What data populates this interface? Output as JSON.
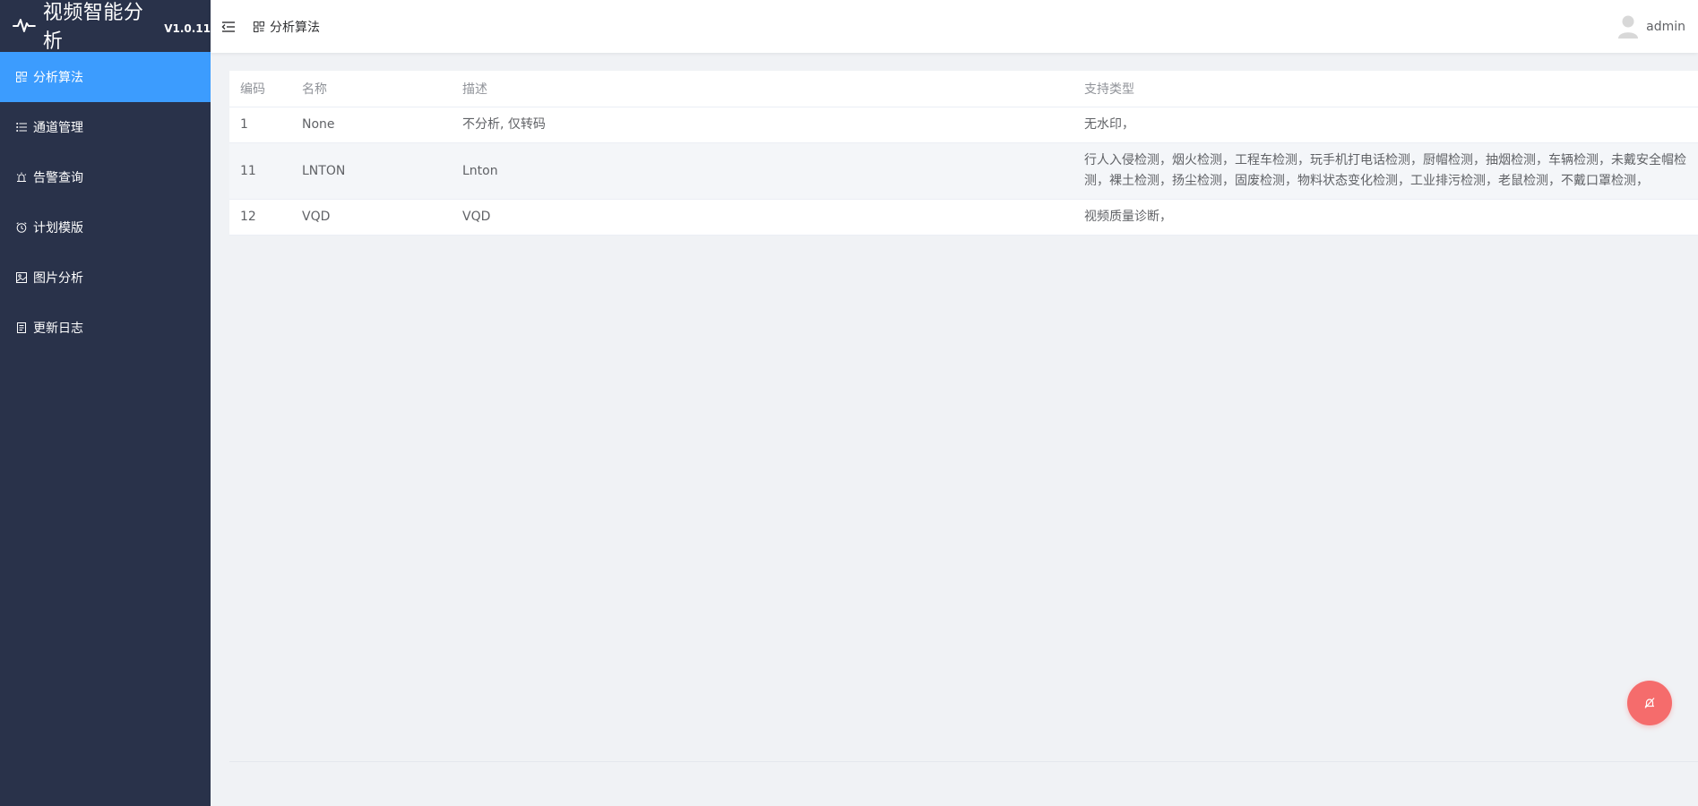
{
  "app": {
    "title": "视频智能分析",
    "version": "V1.0.11"
  },
  "sidebar": {
    "items": [
      {
        "label": "分析算法",
        "icon": "algorithm-icon",
        "active": true
      },
      {
        "label": "通道管理",
        "icon": "list-icon",
        "active": false
      },
      {
        "label": "告警查询",
        "icon": "alarm-icon",
        "active": false
      },
      {
        "label": "计划模版",
        "icon": "clock-icon",
        "active": false
      },
      {
        "label": "图片分析",
        "icon": "picture-icon",
        "active": false
      },
      {
        "label": "更新日志",
        "icon": "document-icon",
        "active": false
      }
    ]
  },
  "header": {
    "breadcrumb": "分析算法",
    "user": "admin"
  },
  "table": {
    "columns": [
      "编码",
      "名称",
      "描述",
      "支持类型"
    ],
    "rows": [
      {
        "code": "1",
        "name": "None",
        "desc": "不分析, 仅转码",
        "types": "无水印，"
      },
      {
        "code": "11",
        "name": "LNTON",
        "desc": "Lnton",
        "types": "行人入侵检测，烟火检测，工程车检测，玩手机打电话检测，厨帽检测，抽烟检测，车辆检测，未戴安全帽检测，裸土检测，扬尘检测，固废检测，物料状态变化检测，工业排污检测，老鼠检测，不戴口罩检测，"
      },
      {
        "code": "12",
        "name": "VQD",
        "desc": "VQD",
        "types": "视频质量诊断，"
      }
    ]
  },
  "colors": {
    "sidebar": "#29324a",
    "active": "#3c9cfe",
    "fab": "#f56c6c"
  }
}
